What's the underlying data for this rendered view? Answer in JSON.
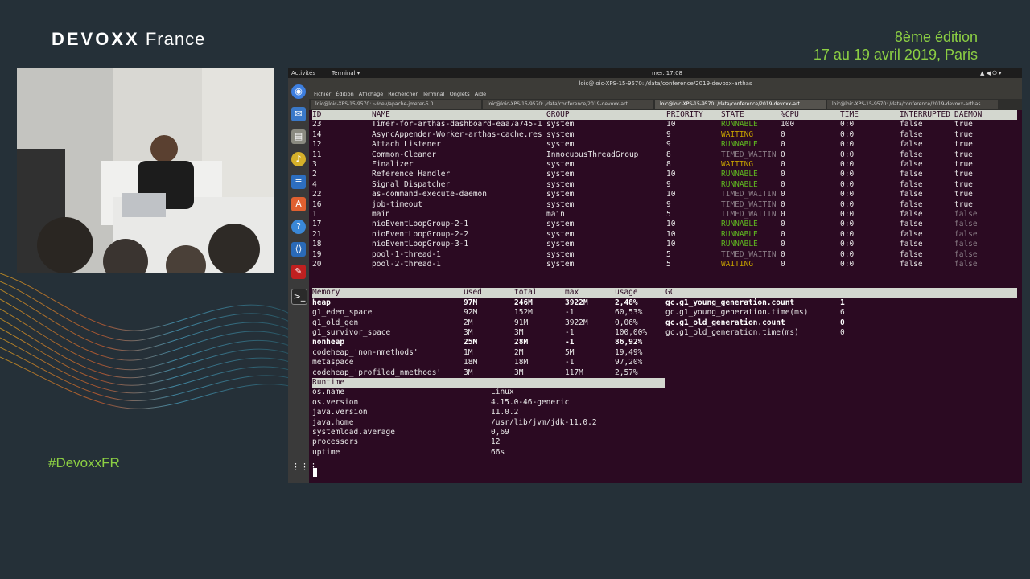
{
  "branding": {
    "logo": "DEVOXX",
    "logo_suffix": "France",
    "edition": "8ème édition",
    "dates": "17 au 19 avril 2019, Paris",
    "hashtag": "#DevoxxFR"
  },
  "topbar": {
    "activities": "Activités",
    "terminal": "Terminal ▾",
    "clock": "mer. 17:08"
  },
  "window": {
    "title": "loic@loic-XPS-15-9570: /data/conference/2019-devoxx-arthas"
  },
  "menu": [
    "Fichier",
    "Édition",
    "Affichage",
    "Rechercher",
    "Terminal",
    "Onglets",
    "Aide"
  ],
  "tabs": [
    "loic@loic-XPS-15-9570: ~/dev/apache-jmeter-5.0",
    "loic@loic-XPS-15-9570: /data/conference/2019-devoxx-art...",
    "loic@loic-XPS-15-9570: /data/conference/2019-devoxx-art...",
    "loic@loic-XPS-15-9570: /data/conference/2019-devoxx-arthas"
  ],
  "threads": {
    "headers": [
      "ID",
      "NAME",
      "GROUP",
      "PRIORITY",
      "STATE",
      "%CPU",
      "TIME",
      "INTERRUPTED",
      "DAEMON"
    ],
    "rows": [
      [
        "23",
        "Timer-for-arthas-dashboard-eaa7a745-1",
        "system",
        "10",
        "RUNNABLE",
        "100",
        "0:0",
        "false",
        "true"
      ],
      [
        "14",
        "AsyncAppender-Worker-arthas-cache.res",
        "system",
        "9",
        "WAITING",
        "0",
        "0:0",
        "false",
        "true"
      ],
      [
        "12",
        "Attach Listener",
        "system",
        "9",
        "RUNNABLE",
        "0",
        "0:0",
        "false",
        "true"
      ],
      [
        "11",
        "Common-Cleaner",
        "InnocuousThreadGroup",
        "8",
        "TIMED_WAITIN",
        "0",
        "0:0",
        "false",
        "true"
      ],
      [
        "3",
        "Finalizer",
        "system",
        "8",
        "WAITING",
        "0",
        "0:0",
        "false",
        "true"
      ],
      [
        "2",
        "Reference Handler",
        "system",
        "10",
        "RUNNABLE",
        "0",
        "0:0",
        "false",
        "true"
      ],
      [
        "4",
        "Signal Dispatcher",
        "system",
        "9",
        "RUNNABLE",
        "0",
        "0:0",
        "false",
        "true"
      ],
      [
        "22",
        "as-command-execute-daemon",
        "system",
        "10",
        "TIMED_WAITIN",
        "0",
        "0:0",
        "false",
        "true"
      ],
      [
        "16",
        "job-timeout",
        "system",
        "9",
        "TIMED_WAITIN",
        "0",
        "0:0",
        "false",
        "true"
      ],
      [
        "1",
        "main",
        "main",
        "5",
        "TIMED_WAITIN",
        "0",
        "0:0",
        "false",
        "false"
      ],
      [
        "17",
        "nioEventLoopGroup-2-1",
        "system",
        "10",
        "RUNNABLE",
        "0",
        "0:0",
        "false",
        "false"
      ],
      [
        "21",
        "nioEventLoopGroup-2-2",
        "system",
        "10",
        "RUNNABLE",
        "0",
        "0:0",
        "false",
        "false"
      ],
      [
        "18",
        "nioEventLoopGroup-3-1",
        "system",
        "10",
        "RUNNABLE",
        "0",
        "0:0",
        "false",
        "false"
      ],
      [
        "19",
        "pool-1-thread-1",
        "system",
        "5",
        "TIMED_WAITIN",
        "0",
        "0:0",
        "false",
        "false"
      ],
      [
        "20",
        "pool-2-thread-1",
        "system",
        "5",
        "WAITING",
        "0",
        "0:0",
        "false",
        "false"
      ]
    ]
  },
  "memory": {
    "headers": [
      "Memory",
      "used",
      "total",
      "max",
      "usage"
    ],
    "rows": [
      [
        "heap",
        "97M",
        "246M",
        "3922M",
        "2,48%"
      ],
      [
        "g1_eden_space",
        "92M",
        "152M",
        "-1",
        "60,53%"
      ],
      [
        "g1_old_gen",
        "2M",
        "91M",
        "3922M",
        "0,06%"
      ],
      [
        "g1_survivor_space",
        "3M",
        "3M",
        "-1",
        "100,00%"
      ],
      [
        "nonheap",
        "25M",
        "28M",
        "-1",
        "86,92%"
      ],
      [
        "codeheap_'non-nmethods'",
        "1M",
        "2M",
        "5M",
        "19,49%"
      ],
      [
        "metaspace",
        "18M",
        "18M",
        "-1",
        "97,20%"
      ],
      [
        "codeheap_'profiled_nmethods'",
        "3M",
        "3M",
        "117M",
        "2,57%"
      ]
    ]
  },
  "gc": {
    "header": "GC",
    "rows": [
      [
        "gc.g1_young_generation.count",
        "1"
      ],
      [
        "gc.g1_young_generation.time(ms)",
        "6"
      ],
      [
        "gc.g1_old_generation.count",
        "0"
      ],
      [
        "gc.g1_old_generation.time(ms)",
        "0"
      ]
    ]
  },
  "runtime": {
    "header": "Runtime",
    "rows": [
      [
        "os.name",
        "Linux"
      ],
      [
        "os.version",
        "4.15.0-46-generic"
      ],
      [
        "java.version",
        "11.0.2"
      ],
      [
        "java.home",
        "/usr/lib/jvm/jdk-11.0.2"
      ],
      [
        "systemload.average",
        "0,69"
      ],
      [
        "processors",
        "12"
      ],
      [
        "uptime",
        "66s"
      ]
    ]
  },
  "colors": {
    "running": "#5fb820",
    "waiting": "#c4a000",
    "timed": "#8a7d86",
    "terminal_bg": "#2b0a22",
    "accent": "#8ccf43"
  }
}
